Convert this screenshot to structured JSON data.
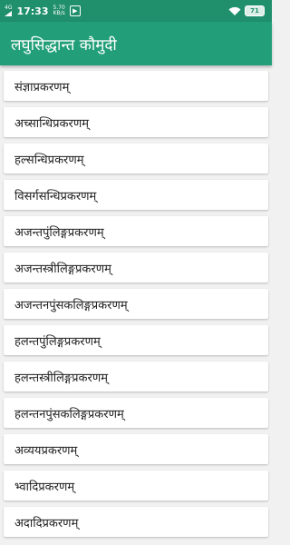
{
  "status_bar": {
    "network": "4G",
    "time": "17:33",
    "speed_value": "5.70",
    "speed_unit": "KB/s",
    "battery": "71"
  },
  "app_bar": {
    "title": "लघुसिद्धान्त कौमुदी"
  },
  "list": {
    "items": [
      "संज्ञाप्रकरणम्",
      "अच्सान्धिप्रकरणम्",
      "हल्सन्धिप्रकरणम्",
      "विसर्गसन्धिप्रकरणम्",
      "अजन्तपुंलिङ्गप्रकरणम्",
      "अजन्तस्त्रीलिङ्गप्रकरणम्",
      "अजन्तनपुंसकलिङ्गप्रकरणम्",
      "हलन्तपुंलिङ्गप्रकरणम्",
      "हलन्तस्त्रीलिङ्गप्रकरणम्",
      "हलन्तनपुंसकलिङ्गप्रकरणम्",
      "अव्ययप्रकरणम्",
      "भ्वादिप्रकरणम्",
      "अदादिप्रकरणम्"
    ]
  },
  "colors": {
    "status_bar": "#1f8f6c",
    "app_bar": "#229f78",
    "background": "#f1f1f1"
  },
  "icons": [
    "wifi-icon",
    "battery-icon",
    "notification-icon"
  ]
}
